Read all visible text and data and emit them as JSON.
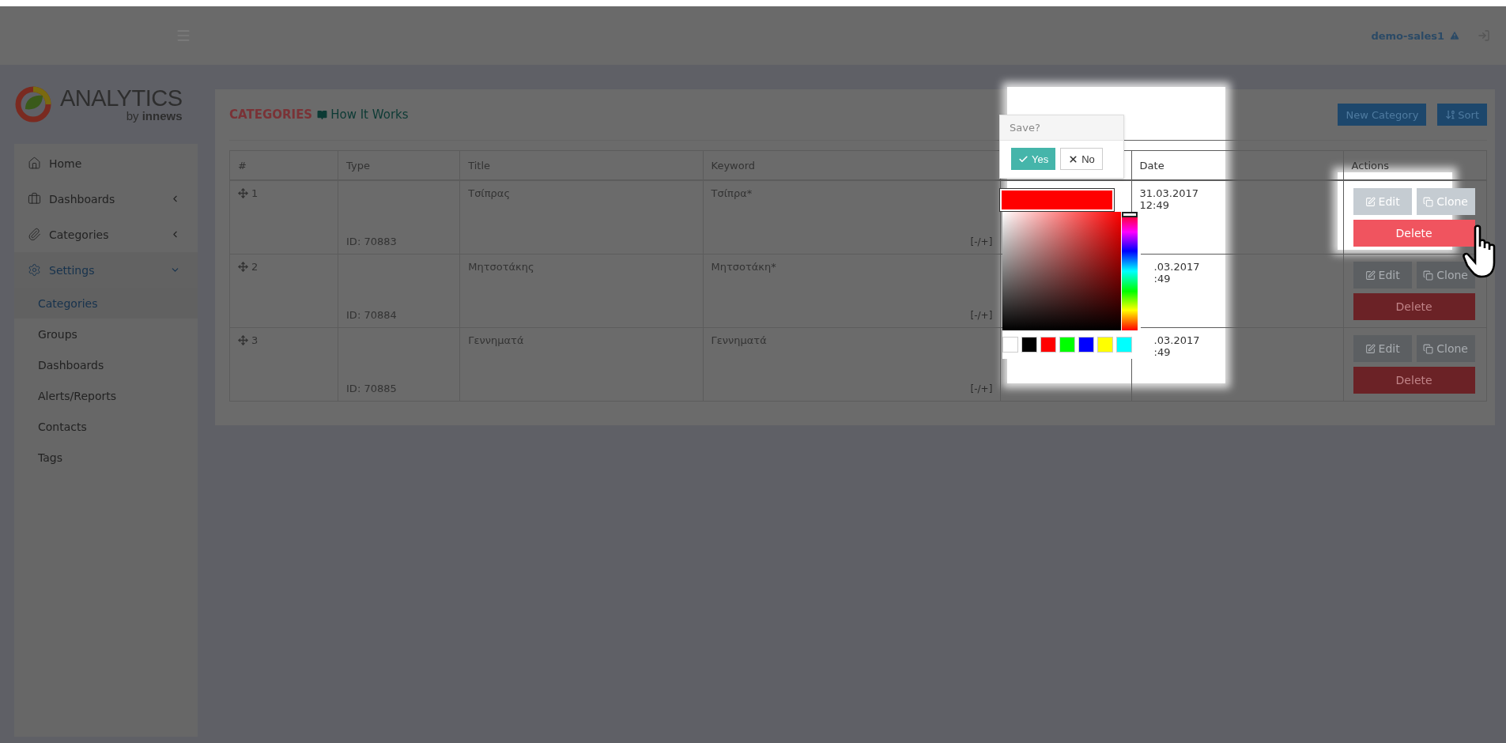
{
  "header": {
    "user": "demo-sales1"
  },
  "logo": {
    "name": "ANALYTICS",
    "by": "by",
    "brand": "innews"
  },
  "sidebar": {
    "items": [
      {
        "label": "Home",
        "selected": false
      },
      {
        "label": "Dashboards",
        "selected": false,
        "expanded": false
      },
      {
        "label": "Categories",
        "selected": false,
        "expanded": false
      },
      {
        "label": "Settings",
        "selected": true,
        "expanded": true,
        "children": [
          {
            "label": "Categories",
            "selected": true
          },
          {
            "label": "Groups",
            "selected": false
          },
          {
            "label": "Dashboards",
            "selected": false
          },
          {
            "label": "Alerts/Reports",
            "selected": false
          },
          {
            "label": "Contacts",
            "selected": false
          },
          {
            "label": "Tags",
            "selected": false
          }
        ]
      }
    ]
  },
  "page": {
    "title": "CATEGORIES",
    "help_link": "How It Works",
    "buttons": [
      {
        "kind": "new",
        "label": "New Category"
      },
      {
        "kind": "sort",
        "label": "Sort"
      }
    ]
  },
  "table": {
    "columns": [
      {
        "kind": "text",
        "label": "#"
      },
      {
        "kind": "text",
        "label": "Type"
      },
      {
        "kind": "text",
        "label": "Title"
      },
      {
        "kind": "text",
        "label": "Keyword"
      },
      {
        "kind": "color"
      },
      {
        "kind": "text",
        "label": "Date"
      },
      {
        "kind": "text",
        "label": "Actions"
      }
    ],
    "rows": [
      {
        "number": "1",
        "id": "ID: 70883",
        "title": "Τσίπρας",
        "keyword": "Τσίπρα*",
        "toggle": "[-/+]",
        "date": "31.03.2017",
        "time": "12:49",
        "highlighted": true,
        "actions": {
          "edit": "Edit",
          "clone": "Clone",
          "delete": "Delete"
        }
      },
      {
        "number": "2",
        "id": "ID: 70884",
        "title": "Μητσοτάκης",
        "keyword": "Μητσοτάκη*",
        "toggle": "[-/+]",
        "date": ".03.2017",
        "time": ":49",
        "highlighted": false,
        "actions": {
          "edit": "Edit",
          "clone": "Clone",
          "delete": "Delete"
        }
      },
      {
        "number": "3",
        "id": "ID: 70885",
        "title": "Γεννηματά",
        "keyword": "Γεννηματά",
        "toggle": "[-/+]",
        "date": ".03.2017",
        "time": ":49",
        "highlighted": false,
        "actions": {
          "edit": "Edit",
          "clone": "Clone",
          "delete": "Delete"
        }
      }
    ]
  },
  "color_picker": {
    "prompt": "Save?",
    "yes": "Yes",
    "no": "No",
    "color": "#ff0000",
    "hue_slider": {
      "level": 0
    },
    "presets": [
      {
        "color": "#ffffff"
      },
      {
        "color": "#000000"
      },
      {
        "color": "#ff0000"
      },
      {
        "color": "#00ff00"
      },
      {
        "color": "#0000ff"
      },
      {
        "color": "#ffff00"
      },
      {
        "color": "#00ffff"
      }
    ]
  }
}
